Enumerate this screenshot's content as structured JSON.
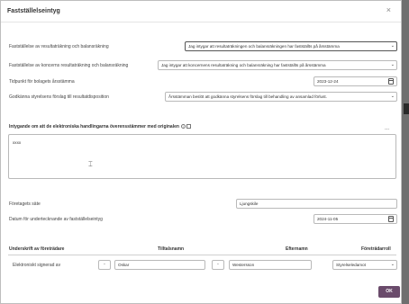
{
  "dialog": {
    "title": "Fastställelseintyg",
    "close_icon": "close-icon"
  },
  "fields": {
    "resultat": {
      "label": "Fastställelse av resultaträkning och balansräkning",
      "value": "Jag intygar att resultaträkningen och balansräkningen har fastställts på årsstämma"
    },
    "koncern": {
      "label": "Fastställelse av koncerns resultaträkning och balansräkning",
      "value": "Jag intygar att koncernens resultaträkning och balansräkning har fastställts på årsstämma"
    },
    "tidpunkt": {
      "label": "Tidpunkt för bolagets årsstämma",
      "value": "2023-12-24"
    },
    "disposition": {
      "label": "Godkänna styrelsens förslag till resultatdisposition",
      "value": "Årsstämman beslöt att godkänna styrelsens förslag till behandling av ansamlad förlust."
    }
  },
  "intygande": {
    "title": "Intygande om att de elektroniska handlingarna överensstämmer med originalen",
    "value": "xxxx",
    "more": "..."
  },
  "foretagets_sate": {
    "label": "Företagets säte",
    "value": "Ljungskile"
  },
  "datum": {
    "label": "Datum för undertecknande av fastställelseintyg",
    "value": "2024-11-05"
  },
  "table": {
    "headers": [
      "Underskrift av företrädare",
      "Tilltalsnamn",
      "Efternamn",
      "Företrädarroll"
    ],
    "row": {
      "signed": "Elektroniskt signerad av",
      "dash1": "-",
      "first_name": "Oskar",
      "dash2": "-",
      "last_name": "Westersson",
      "role": "Styrelseledamot"
    }
  },
  "ok_label": "OK",
  "colors": {
    "primary_button": "#6a4b6b"
  }
}
